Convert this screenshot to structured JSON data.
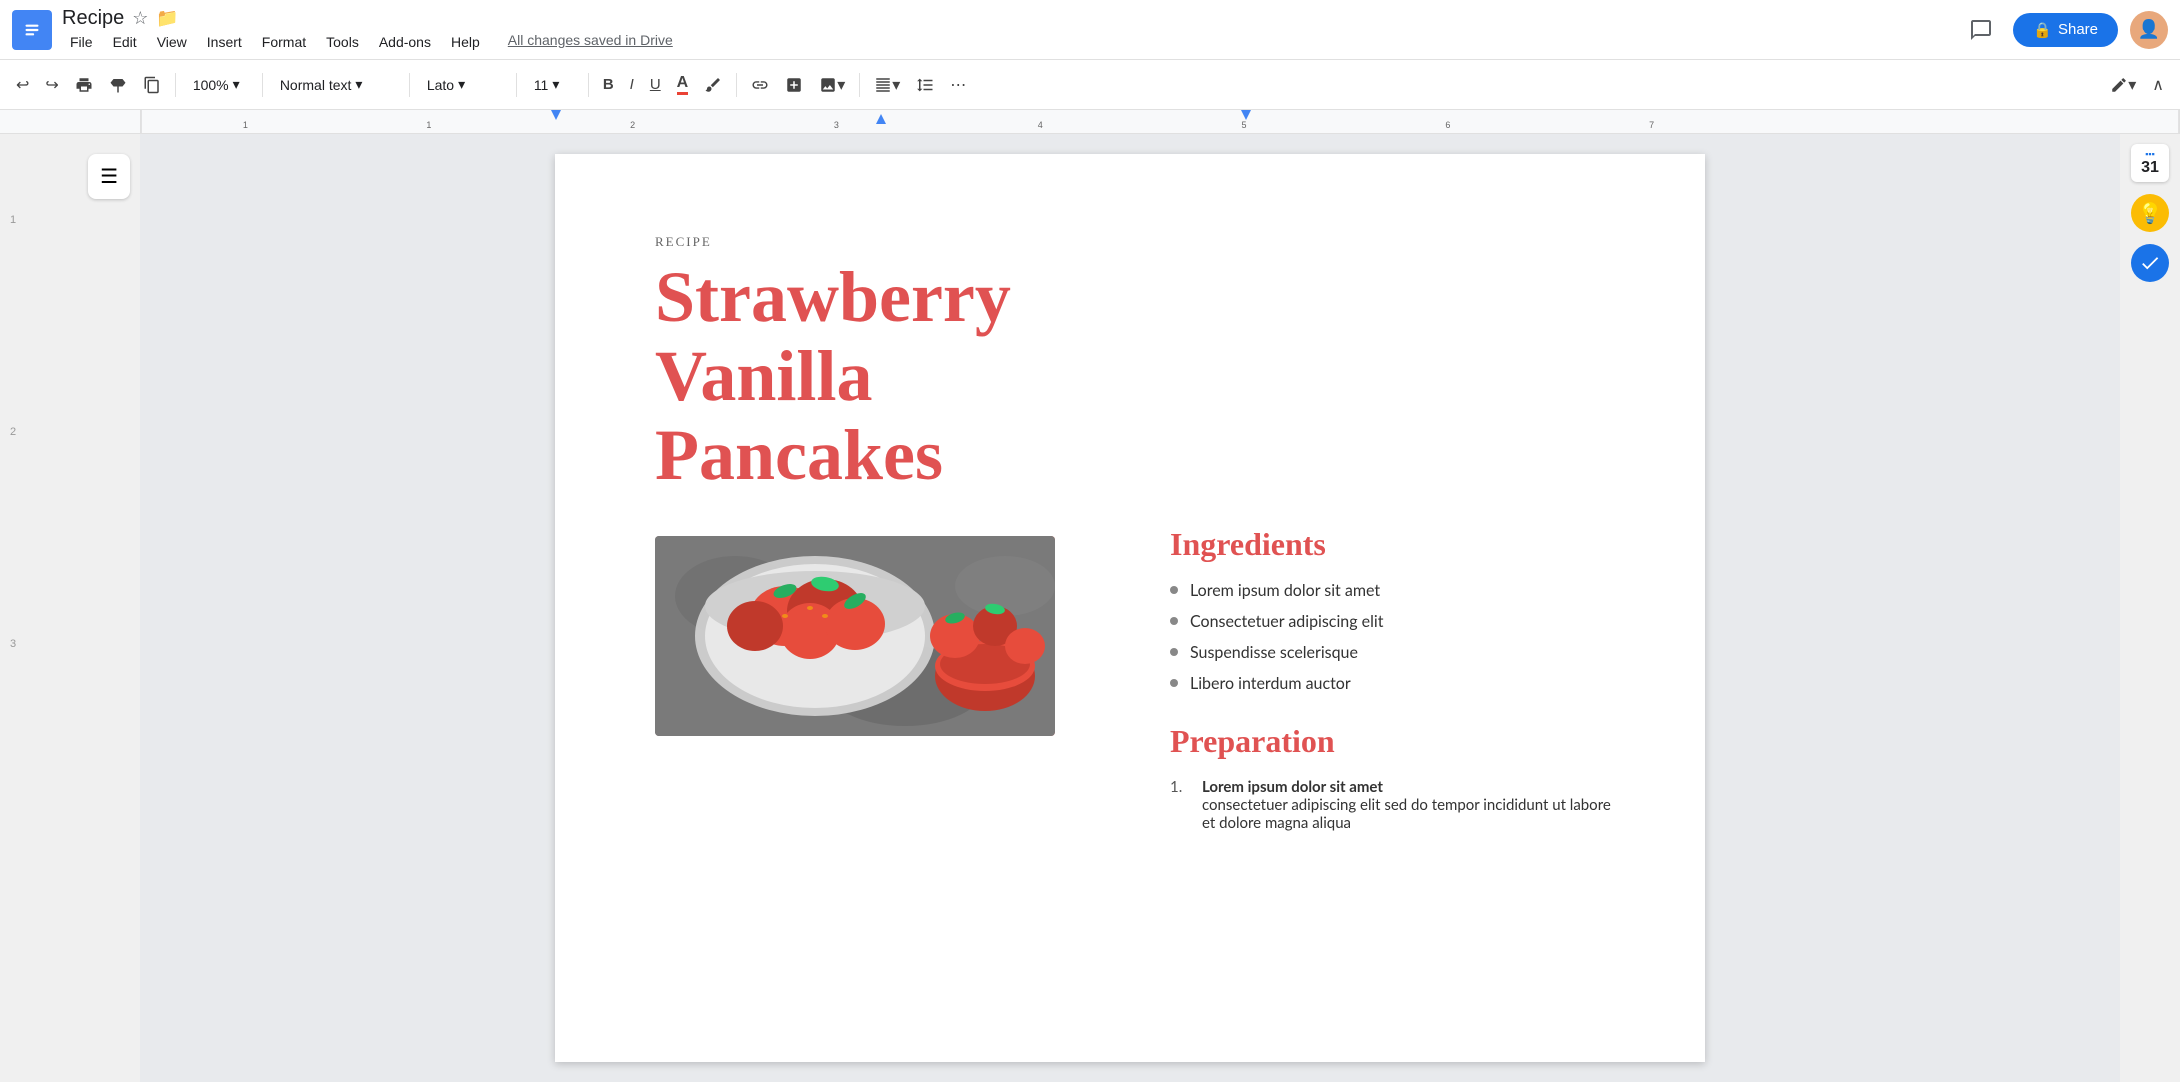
{
  "app": {
    "icon_color": "#4285f4",
    "doc_title": "Recipe",
    "star_symbol": "☆",
    "folder_symbol": "📁",
    "saved_status": "All changes saved in Drive",
    "share_label": "Share",
    "share_icon": "🔒"
  },
  "menu": {
    "items": [
      "File",
      "Edit",
      "View",
      "Insert",
      "Format",
      "Tools",
      "Add-ons",
      "Help"
    ]
  },
  "toolbar": {
    "zoom": "100%",
    "style": "Normal text",
    "font": "Lato",
    "size": "11",
    "undo": "↩",
    "redo": "↪",
    "print": "🖨",
    "paint_format": "✏",
    "clone_format": "⬜",
    "bold": "B",
    "italic": "I",
    "underline": "U",
    "font_color": "A",
    "highlight": "✏",
    "link": "🔗",
    "insert_special": "+",
    "insert_image": "🖼",
    "align": "≡",
    "line_spacing": "↕",
    "more": "⋯",
    "edit_pen": "✏",
    "collapse": "∧"
  },
  "document": {
    "recipe_label": "RECIPE",
    "title_line1": "Strawberry",
    "title_line2": "Vanilla",
    "title_line3": "Pancakes",
    "ingredients_heading": "Ingredients",
    "ingredients": [
      "Lorem ipsum dolor sit amet",
      "Consectetuer adipiscing elit",
      "Suspendisse scelerisque",
      "Libero interdum auctor"
    ],
    "preparation_heading": "Preparation",
    "prep_items": [
      {
        "num": "1.",
        "bold_text": "Lorem ipsum dolor sit amet",
        "body_text": "consectetuer adipiscing elit sed do tempor incididunt ut labore et dolore magna aliqua"
      }
    ]
  },
  "sidebar": {
    "outline_icon": "☰",
    "calendar_top": "31",
    "lightbulb": "💡",
    "check": "✓"
  }
}
